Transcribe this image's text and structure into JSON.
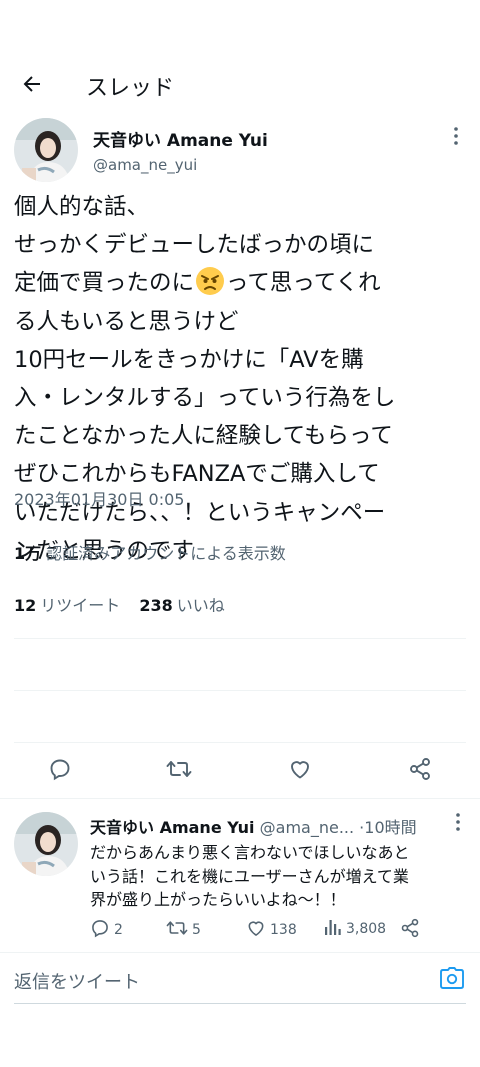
{
  "header": {
    "title": "スレッド"
  },
  "main_tweet": {
    "display_name": "天音ゆい Amane Yui",
    "handle": "@ama_ne_yui",
    "text_before_emoji": "個人的な話、\nせっかくデビューしたばっかの頃に\n定価で買ったのに",
    "emoji": "angry-face",
    "text_after_emoji": "って思ってくれ\nる人もいると思うけど\n10円セールをきっかけに「AVを購\n入・レンタルする」っていう行為をし\nたことなかった人に経験してもらって\nぜひこれからもFANZAでご購入して\nいただけたら、、！というキャンペー\nンだと思うのです",
    "timestamp": "2023年01月30日 0:05",
    "views": {
      "count": "1万",
      "label": "認証済みアカウントによる表示数"
    },
    "retweets": {
      "count": "12",
      "label": "リツイート"
    },
    "likes": {
      "count": "238",
      "label": "いいね"
    }
  },
  "reply": {
    "display_name": "天音ゆい Amane Yui",
    "handle": "@ama_ne...",
    "separator": "·",
    "time": "10時間",
    "text": "だからあんまり悪く言わないでほしいなあと\nいう話！これを機にユーザーさんが増えて業\n界が盛り上がったらいいよね〜！！",
    "replies": "2",
    "retweets": "5",
    "likes": "138",
    "views": "3,808"
  },
  "compose": {
    "placeholder": "返信をツイート"
  },
  "colors": {
    "accent": "#1d9bf0",
    "text_primary": "#0f1419",
    "text_secondary": "#536471",
    "divider": "#eff3f4"
  },
  "icons": {
    "back": "arrow-left-icon",
    "more": "more-vertical-icon",
    "reply": "reply-icon",
    "retweet": "retweet-icon",
    "like": "heart-icon",
    "share": "share-icon",
    "views": "bar-chart-icon",
    "camera": "camera-icon"
  }
}
